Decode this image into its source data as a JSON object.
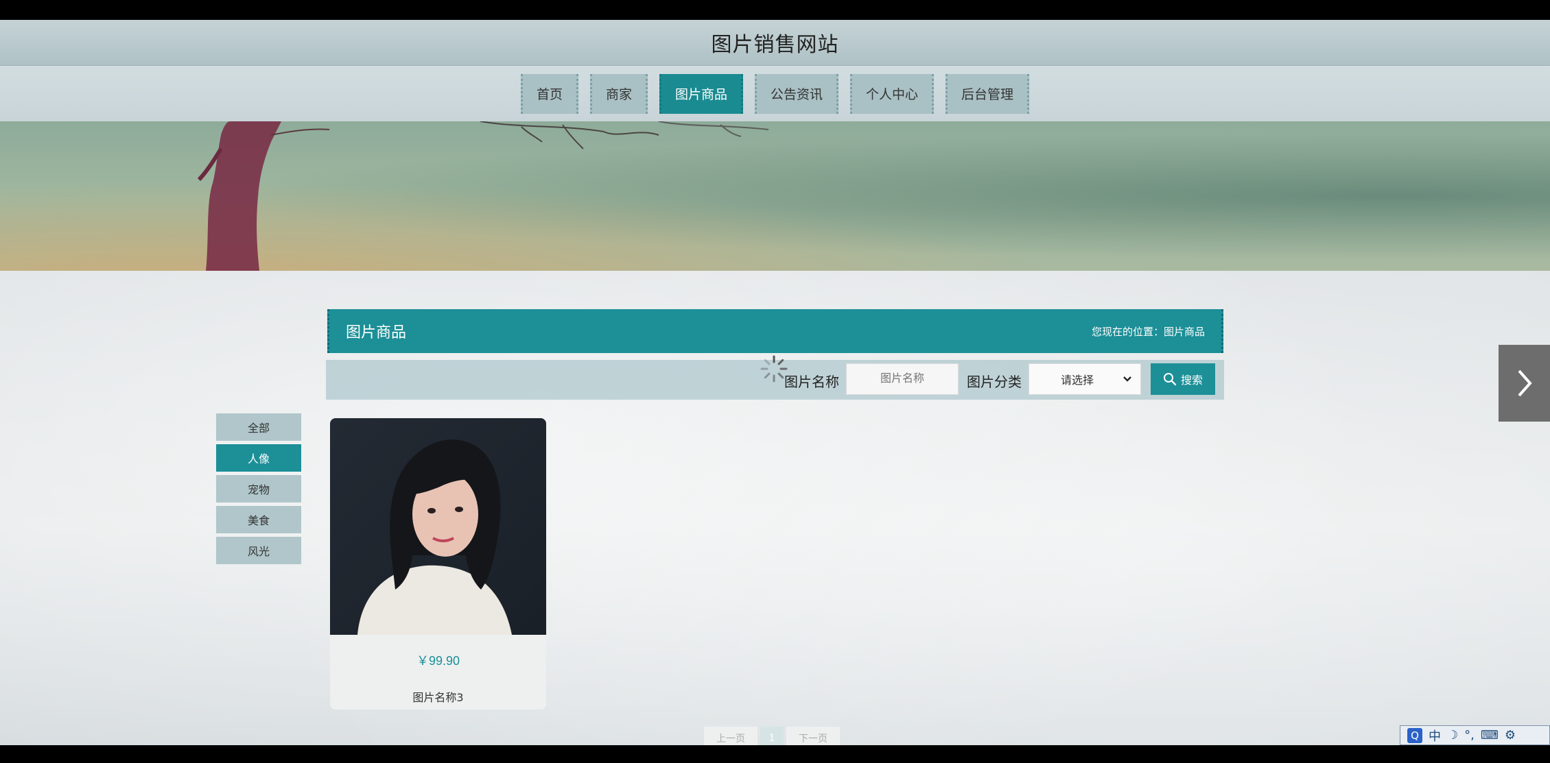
{
  "site": {
    "title": "图片销售网站"
  },
  "nav": {
    "items": [
      {
        "label": "首页"
      },
      {
        "label": "商家"
      },
      {
        "label": "图片商品"
      },
      {
        "label": "公告资讯"
      },
      {
        "label": "个人中心"
      },
      {
        "label": "后台管理"
      }
    ],
    "active_index": 2
  },
  "section": {
    "title": "图片商品",
    "breadcrumb": "您现在的位置：图片商品"
  },
  "search": {
    "name_label": "图片名称",
    "name_placeholder": "图片名称",
    "category_label": "图片分类",
    "category_selected": "请选择",
    "button_label": "搜索"
  },
  "categories": {
    "items": [
      {
        "label": "全部"
      },
      {
        "label": "人像"
      },
      {
        "label": "宠物"
      },
      {
        "label": "美食"
      },
      {
        "label": "风光"
      }
    ],
    "active_index": 1
  },
  "products": [
    {
      "price": "￥99.90",
      "name": "图片名称3"
    }
  ],
  "pagination": {
    "prev_label": "上一页",
    "current_page": "1",
    "next_label": "下一页"
  },
  "ime": {
    "q": "Q",
    "mode": "中"
  },
  "colors": {
    "accent": "#1c8f97",
    "nav_bg": "#a9c0c4",
    "header_bg": "#afc1c5"
  }
}
